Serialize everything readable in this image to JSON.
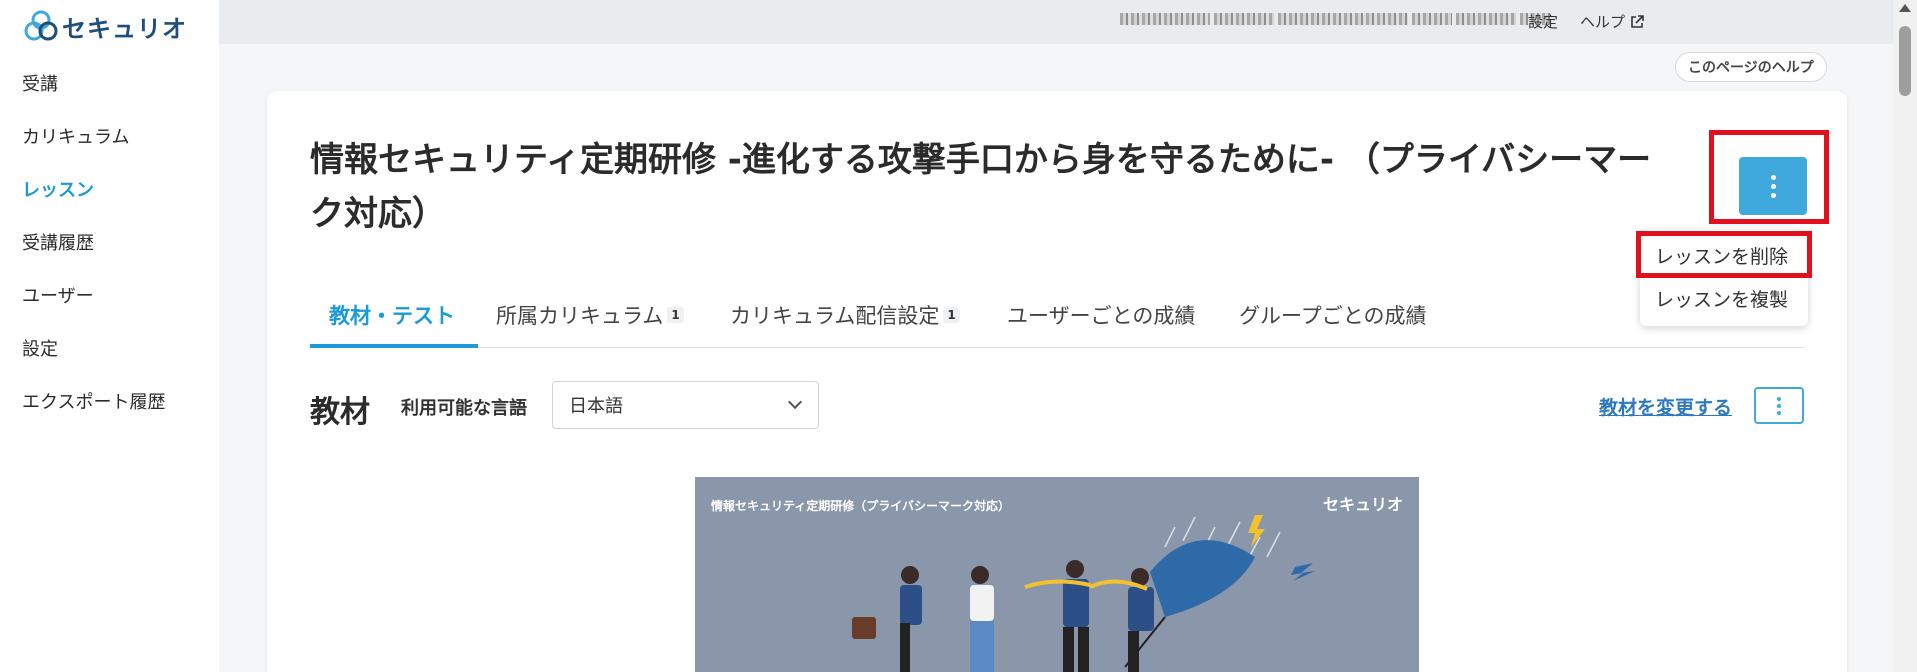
{
  "app": {
    "logo_text": "セキュリオ"
  },
  "sidebar": {
    "items": [
      {
        "label": "受講"
      },
      {
        "label": "カリキュラム"
      },
      {
        "label": "レッスン",
        "active": true
      },
      {
        "label": "受講履歴"
      },
      {
        "label": "ユーザー"
      },
      {
        "label": "設定"
      },
      {
        "label": "エクスポート履歴"
      }
    ]
  },
  "topbar": {
    "settings_label": "設定",
    "help_label": "ヘルプ"
  },
  "page_help_label": "このページのヘルプ",
  "lesson": {
    "title": "情報セキュリティ定期研修 -進化する攻撃手口から身を守るために- （プライバシーマーク対応）"
  },
  "menu": {
    "items": [
      {
        "label": "レッスンを削除"
      },
      {
        "label": "レッスンを複製"
      }
    ]
  },
  "tabs": [
    {
      "label": "教材・テスト",
      "active": true
    },
    {
      "label": "所属カリキュラム",
      "badge": "1"
    },
    {
      "label": "カリキュラム配信設定",
      "badge": "1"
    },
    {
      "label": "ユーザーごとの成績"
    },
    {
      "label": "グループごとの成績"
    }
  ],
  "materials": {
    "title": "教材",
    "language_label": "利用可能な言語",
    "language_value": "日本語",
    "change_link": "教材を変更する"
  },
  "thumbnail": {
    "title": "情報セキュリティ定期研修（プライバシーマーク対応）",
    "logo_text": "セキュリオ"
  },
  "colors": {
    "accent": "#1a9ad6",
    "button": "#3fa9de",
    "highlight": "#e0101c",
    "link": "#2d79bf"
  }
}
